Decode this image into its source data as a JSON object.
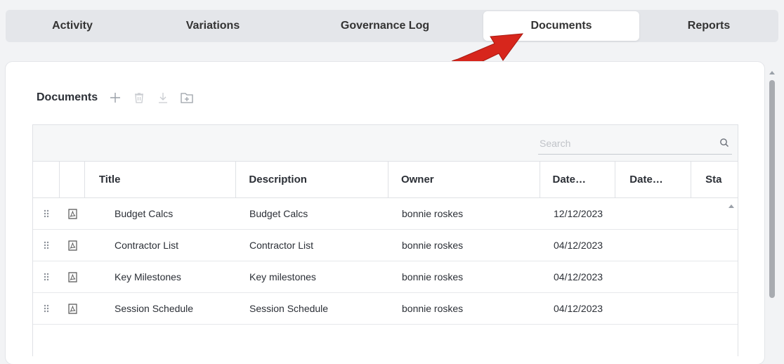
{
  "tabs": [
    {
      "label": "Activity"
    },
    {
      "label": "Variations"
    },
    {
      "label": "Governance Log"
    },
    {
      "label": "Documents",
      "active": true
    },
    {
      "label": "Reports"
    }
  ],
  "documents": {
    "title": "Documents",
    "toolbar_icons": [
      "add-icon",
      "delete-icon",
      "download-icon",
      "add-folder-icon"
    ]
  },
  "grid": {
    "search_placeholder": "Search",
    "columns": [
      "Title",
      "Description",
      "Owner",
      "Date…",
      "Date…",
      "Sta"
    ],
    "rows": [
      {
        "title": "Budget Calcs",
        "description": "Budget Calcs",
        "owner": "bonnie roskes",
        "date": "12/12/2023"
      },
      {
        "title": "Contractor List",
        "description": "Contractor List",
        "owner": "bonnie roskes",
        "date": "04/12/2023"
      },
      {
        "title": "Key Milestones",
        "description": "Key milestones",
        "owner": "bonnie roskes",
        "date": "04/12/2023"
      },
      {
        "title": "Session Schedule",
        "description": "Session Schedule",
        "owner": "bonnie roskes",
        "date": "04/12/2023"
      }
    ]
  },
  "colors": {
    "accent_arrow": "#d7261c",
    "active_tab_bg": "#ffffff",
    "tabbar_bg": "#e4e6ea"
  }
}
